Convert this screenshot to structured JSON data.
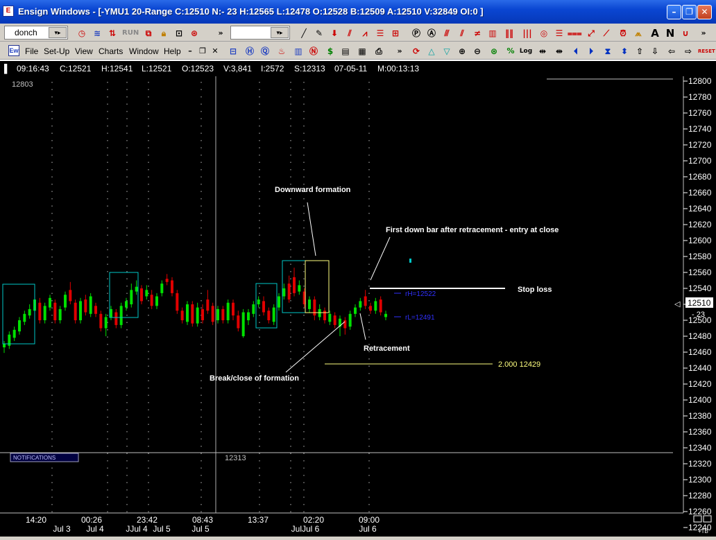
{
  "window": {
    "title": "Ensign Windows - [-YMU1 20-Range C:12510 N:- 23 H:12565 L:12478 O:12528 B:12509 A:12510 V:32849 OI:0 ]"
  },
  "toolbar": {
    "symbol": "donch",
    "run_label": "RUN"
  },
  "menu": [
    "File",
    "Set-Up",
    "View",
    "Charts",
    "Window",
    "Help"
  ],
  "info": {
    "time": "09:16:43",
    "close": "C:12521",
    "high": "H:12541",
    "low": "L:12521",
    "open": "O:12523",
    "volume": "V:3,841",
    "i": "I:2572",
    "s": "S:12313",
    "date": "07-05-11",
    "m": "M:00:13:13"
  },
  "chart_data": {
    "type": "candlestick",
    "instrument": "YMU1 20-Range",
    "y_ticks": [
      12800,
      12780,
      12760,
      12740,
      12720,
      12700,
      12680,
      12660,
      12640,
      12620,
      12600,
      12580,
      12560,
      12540,
      12520,
      12500,
      12480,
      12460,
      12440,
      12420,
      12400,
      12380,
      12360,
      12340,
      12320,
      12300,
      12280,
      12260,
      12240
    ],
    "ylim": [
      12236,
      12804
    ],
    "current_price": "12510",
    "net_change": "- 23",
    "upper_marker": "12803",
    "lower_marker": "12313",
    "x_time_labels": [
      "14:20",
      "00:26",
      "23:42",
      "08:43",
      "13:37",
      "02:20",
      "09:00"
    ],
    "x_date_labels": [
      "Jul 3",
      "Jul 4",
      "JJul 4",
      "Jul 5",
      "Jul 5",
      "JulJul 6",
      "Jul 6"
    ],
    "bars": [
      {
        "o": 12466,
        "c": 12470,
        "h": 12474,
        "l": 12459
      },
      {
        "o": 12468,
        "c": 12482,
        "h": 12486,
        "l": 12464
      },
      {
        "o": 12478,
        "c": 12488,
        "h": 12492,
        "l": 12474
      },
      {
        "o": 12486,
        "c": 12500,
        "h": 12504,
        "l": 12482
      },
      {
        "o": 12498,
        "c": 12508,
        "h": 12512,
        "l": 12494
      },
      {
        "o": 12506,
        "c": 12514,
        "h": 12520,
        "l": 12502
      },
      {
        "o": 12512,
        "c": 12526,
        "h": 12530,
        "l": 12508
      },
      {
        "o": 12522,
        "c": 12500,
        "h": 12528,
        "l": 12496
      },
      {
        "o": 12500,
        "c": 12518,
        "h": 12522,
        "l": 12496
      },
      {
        "o": 12516,
        "c": 12528,
        "h": 12532,
        "l": 12512
      },
      {
        "o": 12522,
        "c": 12500,
        "h": 12526,
        "l": 12496
      },
      {
        "o": 12500,
        "c": 12514,
        "h": 12518,
        "l": 12496
      },
      {
        "o": 12516,
        "c": 12532,
        "h": 12536,
        "l": 12512
      },
      {
        "o": 12538,
        "c": 12524,
        "h": 12548,
        "l": 12520
      },
      {
        "o": 12522,
        "c": 12500,
        "h": 12526,
        "l": 12496
      },
      {
        "o": 12500,
        "c": 12524,
        "h": 12528,
        "l": 12496
      },
      {
        "o": 12526,
        "c": 12510,
        "h": 12532,
        "l": 12506
      },
      {
        "o": 12508,
        "c": 12530,
        "h": 12534,
        "l": 12504
      },
      {
        "o": 12518,
        "c": 12508,
        "h": 12522,
        "l": 12504
      },
      {
        "o": 12508,
        "c": 12490,
        "h": 12512,
        "l": 12486
      },
      {
        "o": 12490,
        "c": 12504,
        "h": 12508,
        "l": 12480
      },
      {
        "o": 12504,
        "c": 12514,
        "h": 12518,
        "l": 12500
      },
      {
        "o": 12510,
        "c": 12494,
        "h": 12514,
        "l": 12490
      },
      {
        "o": 12494,
        "c": 12518,
        "h": 12522,
        "l": 12490
      },
      {
        "o": 12516,
        "c": 12524,
        "h": 12528,
        "l": 12512
      },
      {
        "o": 12520,
        "c": 12538,
        "h": 12546,
        "l": 12516
      },
      {
        "o": 12536,
        "c": 12542,
        "h": 12550,
        "l": 12532
      },
      {
        "o": 12540,
        "c": 12524,
        "h": 12544,
        "l": 12520
      },
      {
        "o": 12530,
        "c": 12538,
        "h": 12544,
        "l": 12526
      },
      {
        "o": 12532,
        "c": 12518,
        "h": 12538,
        "l": 12514
      },
      {
        "o": 12518,
        "c": 12530,
        "h": 12534,
        "l": 12514
      },
      {
        "o": 12534,
        "c": 12546,
        "h": 12550,
        "l": 12530
      },
      {
        "o": 12552,
        "c": 12548,
        "h": 12558,
        "l": 12544
      },
      {
        "o": 12550,
        "c": 12534,
        "h": 12554,
        "l": 12530
      },
      {
        "o": 12534,
        "c": 12512,
        "h": 12538,
        "l": 12508
      },
      {
        "o": 12512,
        "c": 12500,
        "h": 12516,
        "l": 12496
      },
      {
        "o": 12498,
        "c": 12520,
        "h": 12524,
        "l": 12494
      },
      {
        "o": 12520,
        "c": 12496,
        "h": 12524,
        "l": 12492
      },
      {
        "o": 12496,
        "c": 12516,
        "h": 12522,
        "l": 12492
      },
      {
        "o": 12514,
        "c": 12500,
        "h": 12520,
        "l": 12496
      },
      {
        "o": 12526,
        "c": 12512,
        "h": 12538,
        "l": 12508
      },
      {
        "o": 12518,
        "c": 12498,
        "h": 12522,
        "l": 12494
      },
      {
        "o": 12500,
        "c": 12514,
        "h": 12518,
        "l": 12496
      },
      {
        "o": 12514,
        "c": 12500,
        "h": 12518,
        "l": 12496
      },
      {
        "o": 12500,
        "c": 12522,
        "h": 12526,
        "l": 12496
      },
      {
        "o": 12522,
        "c": 12506,
        "h": 12526,
        "l": 12500
      },
      {
        "o": 12506,
        "c": 12490,
        "h": 12512,
        "l": 12486
      },
      {
        "o": 12480,
        "c": 12510,
        "h": 12514,
        "l": 12478
      },
      {
        "o": 12500,
        "c": 12510,
        "h": 12514,
        "l": 12494
      },
      {
        "o": 12508,
        "c": 12520,
        "h": 12524,
        "l": 12504
      },
      {
        "o": 12520,
        "c": 12526,
        "h": 12530,
        "l": 12516
      },
      {
        "o": 12524,
        "c": 12510,
        "h": 12530,
        "l": 12506
      },
      {
        "o": 12512,
        "c": 12500,
        "h": 12516,
        "l": 12496
      },
      {
        "o": 12498,
        "c": 12516,
        "h": 12520,
        "l": 12494
      },
      {
        "o": 12516,
        "c": 12530,
        "h": 12534,
        "l": 12512
      },
      {
        "o": 12530,
        "c": 12540,
        "h": 12546,
        "l": 12526
      },
      {
        "o": 12546,
        "c": 12526,
        "h": 12556,
        "l": 12522
      },
      {
        "o": 12554,
        "c": 12534,
        "h": 12566,
        "l": 12530
      },
      {
        "o": 12536,
        "c": 12544,
        "h": 12550,
        "l": 12532
      },
      {
        "o": 12536,
        "c": 12520,
        "h": 12540,
        "l": 12516
      },
      {
        "o": 12514,
        "c": 12526,
        "h": 12530,
        "l": 12510
      },
      {
        "o": 12526,
        "c": 12506,
        "h": 12530,
        "l": 12500
      },
      {
        "o": 12504,
        "c": 12514,
        "h": 12520,
        "l": 12500
      },
      {
        "o": 12512,
        "c": 12500,
        "h": 12516,
        "l": 12496
      },
      {
        "o": 12498,
        "c": 12508,
        "h": 12512,
        "l": 12494
      },
      {
        "o": 12506,
        "c": 12494,
        "h": 12510,
        "l": 12490
      },
      {
        "o": 12492,
        "c": 12502,
        "h": 12506,
        "l": 12480
      },
      {
        "o": 12500,
        "c": 12490,
        "h": 12504,
        "l": 12482
      },
      {
        "o": 12492,
        "c": 12508,
        "h": 12512,
        "l": 12488
      },
      {
        "o": 12508,
        "c": 12516,
        "h": 12520,
        "l": 12504
      },
      {
        "o": 12516,
        "c": 12524,
        "h": 12528,
        "l": 12512
      },
      {
        "o": 12530,
        "c": 12518,
        "h": 12538,
        "l": 12514
      },
      {
        "o": 12518,
        "c": 12512,
        "h": 12522,
        "l": 12508
      },
      {
        "o": 12512,
        "c": 12524,
        "h": 12528,
        "l": 12508
      },
      {
        "o": 12526,
        "c": 12510,
        "h": 12530,
        "l": 12506
      },
      {
        "o": 12504,
        "c": 12508,
        "h": 12512,
        "l": 12500
      }
    ],
    "stop_loss_price": 12540,
    "labels": {
      "downward_formation": "Downward formation",
      "first_down_bar": "First down bar after retracement - entry at close",
      "stop_loss": "Stop loss",
      "retracement": "Retracement",
      "break_close": "Break/close of formation",
      "rH": "rH=12522",
      "rL": "rL=12491",
      "target": "2.000  12429"
    },
    "notifications": "NOTIFICATIONS",
    "corner_label": "+TB",
    "colors": {
      "up": "#00e000",
      "down": "#e00000",
      "box": "#00c8c8",
      "yellow": "#ffff80",
      "blue": "#3030ff",
      "grid": "#808080",
      "axis_text": "#ffffff"
    }
  }
}
